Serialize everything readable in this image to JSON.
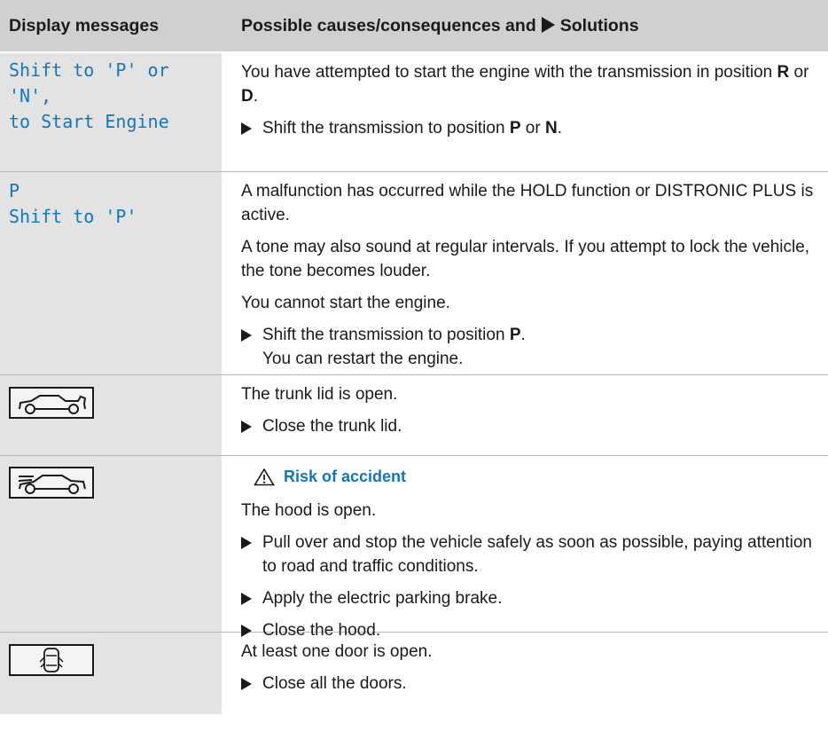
{
  "header": {
    "col1": "Display messages",
    "col2_before": "Possible causes/consequences and",
    "col2_after": "Solutions"
  },
  "rows": [
    {
      "display_lines": [
        "Shift to 'P' or",
        "'N',",
        "to Start Engine"
      ],
      "p1_a": "You have attempted to start the engine with the transmission in position ",
      "p1_b1": "R",
      "p1_c": " or ",
      "p1_b2": "D",
      "p1_d": ".",
      "s1_a": "Shift the transmission to position ",
      "s1_b1": "P",
      "s1_c": " or ",
      "s1_b2": "N",
      "s1_d": "."
    },
    {
      "display_lines": [
        "P",
        "Shift to 'P'"
      ],
      "p1": "A malfunction has occurred while the HOLD function or DISTRONIC PLUS is active.",
      "p2": "A tone may also sound at regular intervals. If you attempt to lock the vehicle, the tone becomes louder.",
      "p3": "You cannot start the engine.",
      "s1_a": "Shift the transmission to position ",
      "s1_b": "P",
      "s1_c": ".",
      "s1_sub": "You can restart the engine."
    },
    {
      "icon": "trunk-open-icon",
      "p1": "The trunk lid is open.",
      "s1": "Close the trunk lid."
    },
    {
      "icon": "hood-open-icon",
      "warning": "Risk of accident",
      "p1": "The hood is open.",
      "s1": "Pull over and stop the vehicle safely as soon as possible, paying attention to road and traffic conditions.",
      "s2": "Apply the electric parking brake.",
      "s3": "Close the hood."
    },
    {
      "icon": "door-open-icon",
      "p1": "At least one door is open.",
      "s1": "Close all the doors."
    }
  ],
  "colors": {
    "accent": "#1477b8",
    "header_bg": "#d0d0d0",
    "left_col_bg": "#e3e3e3"
  }
}
